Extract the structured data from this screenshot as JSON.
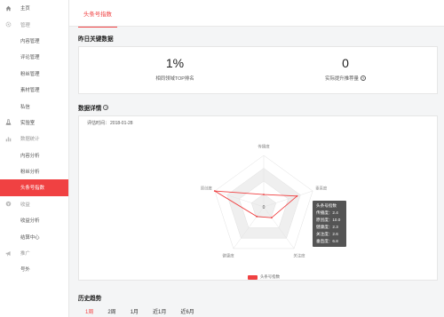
{
  "sidebar": {
    "items": [
      {
        "label": "主页",
        "icon": "home-icon",
        "kind": "top"
      },
      {
        "label": "管理",
        "icon": "gear-icon",
        "kind": "group"
      },
      {
        "label": "内容管理",
        "kind": "sub"
      },
      {
        "label": "评论管理",
        "kind": "sub"
      },
      {
        "label": "粉丝管理",
        "kind": "sub"
      },
      {
        "label": "素材管理",
        "kind": "sub"
      },
      {
        "label": "私信",
        "kind": "sub"
      },
      {
        "label": "实验室",
        "icon": "flask-icon",
        "kind": "top"
      },
      {
        "label": "数据统计",
        "icon": "bar-chart-icon",
        "kind": "group"
      },
      {
        "label": "内容分析",
        "kind": "sub"
      },
      {
        "label": "粉丝分析",
        "kind": "sub"
      },
      {
        "label": "头条号指数",
        "kind": "sub",
        "active": true
      },
      {
        "label": "收益",
        "icon": "coin-icon",
        "kind": "group"
      },
      {
        "label": "收益分析",
        "kind": "sub"
      },
      {
        "label": "结算中心",
        "kind": "sub"
      },
      {
        "label": "推广",
        "icon": "megaphone-icon",
        "kind": "group"
      },
      {
        "label": "号外",
        "kind": "sub"
      }
    ]
  },
  "tabs": {
    "active_label": "头条号指数"
  },
  "yesterday": {
    "title": "昨日关键数据",
    "kpis": [
      {
        "value": "1%",
        "label": "相同领域TOP排名"
      },
      {
        "value": "0",
        "label": "实际提升推荐量"
      }
    ]
  },
  "detail": {
    "title": "数据详情",
    "eval_label": "评估时间：",
    "eval_date": "2018-01-28"
  },
  "radar": {
    "axes": [
      "传播度",
      "垂直度",
      "关注度",
      "健康度",
      "原创度"
    ],
    "center_label": "0",
    "legend": "头条号指数",
    "tooltip": {
      "title": "头条号指数",
      "lines": [
        "传播度：2.4",
        "原创度：10.0",
        "健康度：2.3",
        "关注度：2.6",
        "垂直度：6.8"
      ]
    }
  },
  "chart_data": {
    "type": "radar",
    "axes": [
      "传播度",
      "垂直度",
      "关注度",
      "健康度",
      "原创度"
    ],
    "series": [
      {
        "name": "头条号指数",
        "values": [
          2.4,
          6.8,
          2.6,
          2.3,
          10.0
        ]
      }
    ],
    "range": [
      0,
      10
    ]
  },
  "history": {
    "title": "历史趋势",
    "tabs": [
      "1周",
      "2周",
      "1月",
      "近1月",
      "近6月"
    ]
  },
  "colors": {
    "accent": "#f04142"
  }
}
